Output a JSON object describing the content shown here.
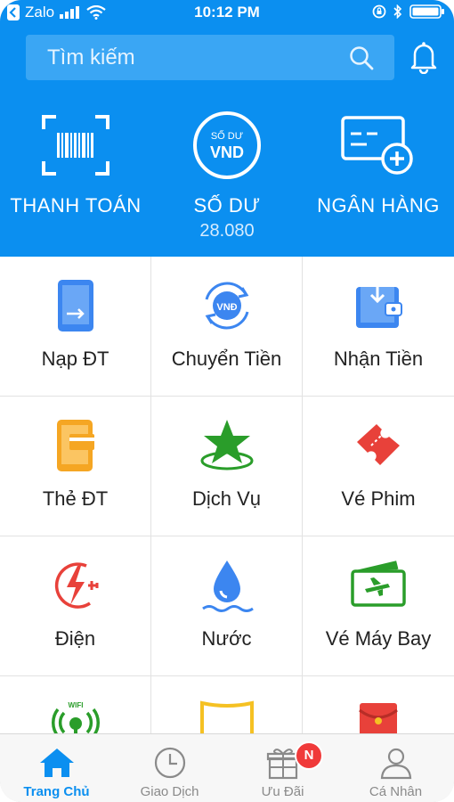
{
  "status": {
    "carrier": "Zalo",
    "time": "10:12 PM"
  },
  "search": {
    "placeholder": "Tìm kiếm"
  },
  "quick": [
    {
      "label": "THANH TOÁN",
      "icon": "barcode-scan-icon"
    },
    {
      "label": "SỐ DƯ",
      "icon": "balance-coin-icon",
      "coin_top": "SỐ DƯ",
      "coin_main": "VND",
      "value": "28.080"
    },
    {
      "label": "NGÂN HÀNG",
      "icon": "bank-card-add-icon"
    }
  ],
  "services": [
    {
      "label": "Nạp ĐT",
      "icon": "phone-topup-icon"
    },
    {
      "label": "Chuyển Tiền",
      "icon": "transfer-money-icon",
      "coin": "VNĐ"
    },
    {
      "label": "Nhận Tiền",
      "icon": "receive-money-icon"
    },
    {
      "label": "Thẻ ĐT",
      "icon": "phone-card-icon"
    },
    {
      "label": "Dịch Vụ",
      "icon": "star-service-icon"
    },
    {
      "label": "Vé Phim",
      "icon": "movie-ticket-icon"
    },
    {
      "label": "Điện",
      "icon": "electricity-icon"
    },
    {
      "label": "Nước",
      "icon": "water-drop-icon"
    },
    {
      "label": "Vé Máy Bay",
      "icon": "flight-ticket-icon"
    },
    {
      "label": "",
      "icon": "wifi-icon",
      "wifi_text": "WIFI"
    },
    {
      "label": "",
      "icon": "yellow-frame-icon"
    },
    {
      "label": "",
      "icon": "red-envelope-icon"
    }
  ],
  "tabs": [
    {
      "label": "Trang Chủ",
      "icon": "home-icon",
      "active": true
    },
    {
      "label": "Giao Dịch",
      "icon": "clock-icon"
    },
    {
      "label": "Ưu Đãi",
      "icon": "gift-icon",
      "badge": "N"
    },
    {
      "label": "Cá Nhân",
      "icon": "user-icon"
    }
  ],
  "colors": {
    "primary": "#0b8ff0",
    "accent_orange": "#f5a623",
    "green": "#2a9d2a",
    "red": "#e8413a"
  }
}
